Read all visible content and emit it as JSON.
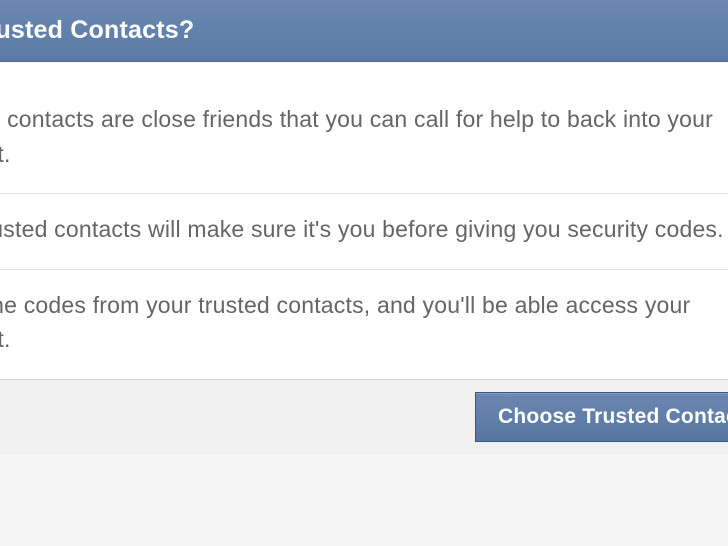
{
  "header": {
    "title": "Are Trusted Contacts?"
  },
  "body": {
    "rows": [
      "Trusted contacts are close friends that you can call for help to back into your account.",
      "Your trusted contacts will make sure it's you before giving you security codes.",
      "Enter the codes from your trusted contacts, and you'll be able access your account."
    ]
  },
  "footer": {
    "primary_button_label": "Choose Trusted Contacts"
  }
}
